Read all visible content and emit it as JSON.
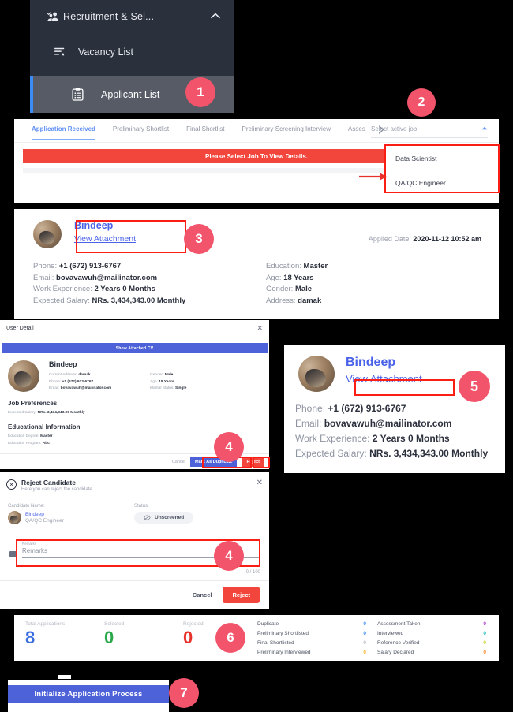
{
  "sidebar": {
    "parent": {
      "label": "Recruitment & Sel...",
      "icon": "users-check-icon",
      "chevron": "chevron-up-icon"
    },
    "items": [
      {
        "label": "Vacancy List",
        "icon": "list-star-icon"
      },
      {
        "label": "Applicant List",
        "icon": "clipboard-list-icon"
      }
    ]
  },
  "badges": {
    "b1": "1",
    "b2": "2",
    "b3": "3",
    "b4a": "4",
    "b4b": "4",
    "b5": "5",
    "b6": "6",
    "b7": "7",
    "color": "#f2556b"
  },
  "tabs": {
    "items": [
      "Application Received",
      "Preliminary Shortlist",
      "Final Shortlist",
      "Preliminary Screening Interview",
      "Asses"
    ],
    "active": "Application Received",
    "more_icon": "chevron-right-icon"
  },
  "select_job": {
    "placeholder": "Select active job",
    "caret": "caret-up-icon",
    "options": [
      "Data Scientist",
      "QA/QC Engineer"
    ]
  },
  "banner": {
    "text": "Please Select Job To View Details."
  },
  "applicant_card": {
    "name": "Bindeep",
    "attachment_link": "View Attachment",
    "applied_label": "Applied Date:",
    "applied_value": "2020-11-12 10:52 am",
    "left": [
      {
        "label": "Phone:",
        "value": "+1 (672) 913-6767"
      },
      {
        "label": "Email:",
        "value": "bovavawuh@mailinator.com"
      },
      {
        "label": "Work Experience:",
        "value": "2 Years 0 Months"
      },
      {
        "label": "Expected Salary:",
        "value": "NRs. 3,434,343.00 Monthly"
      }
    ],
    "right": [
      {
        "label": "Education:",
        "value": "Master"
      },
      {
        "label": "Age:",
        "value": "18 Years"
      },
      {
        "label": "Gender:",
        "value": "Male"
      },
      {
        "label": "Address:",
        "value": "damak"
      }
    ]
  },
  "user_detail_modal": {
    "title": "User Detail",
    "close_icon": "close-icon",
    "show_cv_button": "Show Attached CV",
    "name": "Bindeep",
    "fields_left": [
      {
        "label": "Current Address:",
        "value": "damak"
      },
      {
        "label": "Phone:",
        "value": "+1 (672) 913-6767"
      },
      {
        "label": "Email:",
        "value": "bovavawuh@mailinator.com"
      }
    ],
    "fields_right": [
      {
        "label": "Gender:",
        "value": "Male"
      },
      {
        "label": "Age:",
        "value": "18 Years"
      },
      {
        "label": "Marital Status:",
        "value": "Single"
      }
    ],
    "job_pref_heading": "Job Preferences",
    "job_pref": [
      {
        "label": "Expected Salary:",
        "value": "NRs. 3,434,343.00 Monthly"
      }
    ],
    "edu_heading": "Educational Information",
    "edu": [
      {
        "label": "Education Degree:",
        "value": "Master"
      },
      {
        "label": "Education Program:",
        "value": "Abc"
      }
    ],
    "cancel_label": "Cancel",
    "duplicate_label": "Mark As Duplicate",
    "reject_label": "Reject"
  },
  "reject_modal": {
    "title": "Reject Candidate",
    "subtitle": "Here you can reject the candidate",
    "header_icon": "circle-x-icon",
    "close_icon": "close-icon",
    "candidate_label": "Candidate Name:",
    "candidate_name": "Bindeep",
    "candidate_role": "QA/QC Engineer",
    "status_label": "Status:",
    "status_value": "Unscreened",
    "status_icon": "eye-off-icon",
    "remarks_icon": "note-icon",
    "remarks_caption": "Remarks",
    "remarks_placeholder": "Remarks",
    "char_counter": "0 / 100",
    "cancel_label": "Cancel",
    "reject_label": "Reject"
  },
  "detail_card": {
    "name": "Bindeep",
    "attachment_link": "View Attachment",
    "lines": [
      {
        "label": "Phone:",
        "value": "+1 (672) 913-6767"
      },
      {
        "label": "Email:",
        "value": "bovavawuh@mailinator.com"
      },
      {
        "label": "Work Experience:",
        "value": "2 Years 0 Months"
      },
      {
        "label": "Expected Salary:",
        "value": "NRs. 3,434,343.00 Monthly"
      }
    ]
  },
  "stats": {
    "primary": [
      {
        "label": "Total Applications",
        "value": "8",
        "color": "#3b6fe0"
      },
      {
        "label": "Selected",
        "value": "0",
        "color": "#2aa84a"
      },
      {
        "label": "Rejected",
        "value": "0",
        "color": "#e8312a"
      }
    ],
    "col1": [
      {
        "label": "Duplicate",
        "value": "0",
        "color": "#3b8df5"
      },
      {
        "label": "Preliminary Shortlisted",
        "value": "0",
        "color": "#3b8df5"
      },
      {
        "label": "Final Shortlisted",
        "value": "0",
        "color": "#b6bac4"
      },
      {
        "label": "Preliminary Interviewed",
        "value": "0",
        "color": "#f5b731"
      }
    ],
    "col2": [
      {
        "label": "Assessment Taken",
        "value": "0",
        "color": "#b23bd4"
      },
      {
        "label": "Interviewed",
        "value": "0",
        "color": "#1fbfb8"
      },
      {
        "label": "Reference Verified",
        "value": "0",
        "color": "#c3d32a"
      },
      {
        "label": "Salary Declared",
        "value": "0",
        "color": "#f58b31"
      }
    ]
  },
  "init_process": {
    "label": "Initialize Application Process"
  }
}
